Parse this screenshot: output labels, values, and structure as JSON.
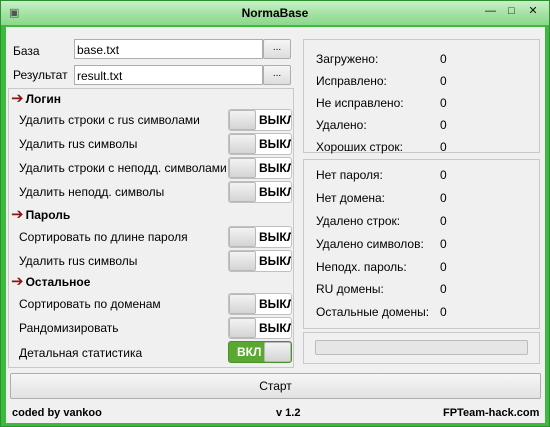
{
  "window": {
    "title": "NormaBase",
    "icon": "app-icon",
    "controls": {
      "minimize": "—",
      "maximize": "□",
      "close": "✕"
    }
  },
  "inputs": {
    "base_label": "База",
    "base_value": "base.txt",
    "result_label": "Результат",
    "result_value": "result.txt",
    "browse_label": "..."
  },
  "options": {
    "sections": [
      {
        "title": "Логин",
        "items": [
          {
            "label": "Удалить строки с rus символами",
            "state": "ВЫКЛ",
            "on": false
          },
          {
            "label": "Удалить rus символы",
            "state": "ВЫКЛ",
            "on": false
          },
          {
            "label": "Удалить строки с неподд. символами",
            "state": "ВЫКЛ",
            "on": false
          },
          {
            "label": "Удалить неподд. символы",
            "state": "ВЫКЛ",
            "on": false
          }
        ]
      },
      {
        "title": "Пароль",
        "items": [
          {
            "label": "Сортировать по длине пароля",
            "state": "ВЫКЛ",
            "on": false
          },
          {
            "label": "Удалить rus символы",
            "state": "ВЫКЛ",
            "on": false
          }
        ]
      },
      {
        "title": "Остальное",
        "items": [
          {
            "label": "Сортировать по доменам",
            "state": "ВЫКЛ",
            "on": false
          },
          {
            "label": "Рандомизировать",
            "state": "ВЫКЛ",
            "on": false
          },
          {
            "label": "Детальная статистика",
            "state": "ВКЛ",
            "on": true
          }
        ]
      }
    ]
  },
  "stats_top": [
    {
      "label": "Загружено:",
      "value": "0"
    },
    {
      "label": "Исправлено:",
      "value": "0"
    },
    {
      "label": "Не исправлено:",
      "value": "0"
    },
    {
      "label": "Удалено:",
      "value": "0"
    },
    {
      "label": "Хороших строк:",
      "value": "0"
    }
  ],
  "stats_detail": [
    {
      "label": "Нет пароля:",
      "value": "0"
    },
    {
      "label": "Нет домена:",
      "value": "0"
    },
    {
      "label": "Удалено строк:",
      "value": "0"
    },
    {
      "label": "Удалено символов:",
      "value": "0"
    },
    {
      "label": "Неподх. пароль:",
      "value": "0"
    },
    {
      "label": "RU домены:",
      "value": "0"
    },
    {
      "label": "Остальные домены:",
      "value": "0"
    }
  ],
  "progress": {
    "fraction": 0
  },
  "start_label": "Старт",
  "footer": {
    "author": "coded by vankoo",
    "version": "v 1.2",
    "site": "FPTeam-hack.com"
  },
  "colors": {
    "frame": "#3dba3d",
    "arrow": "#8b1414",
    "toggle_on": "#5aa832"
  }
}
